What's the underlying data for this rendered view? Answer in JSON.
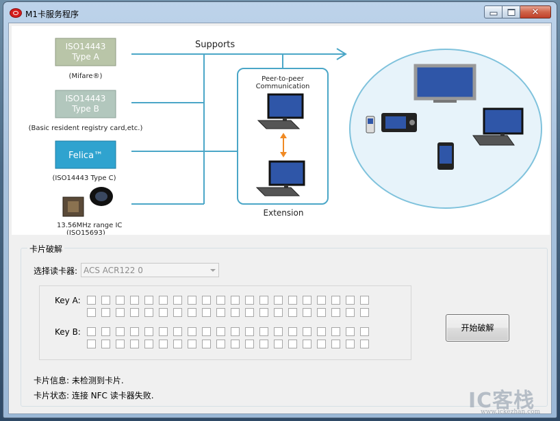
{
  "window": {
    "title": "M1卡服务程序"
  },
  "banner": {
    "supports": "Supports",
    "type_a": [
      "ISO14443",
      "Type A"
    ],
    "mifare": "(Mifare®)",
    "type_b": [
      "ISO14443",
      "Type B"
    ],
    "basic_resident": "(Basic resident registry card,etc.)",
    "felica": "Felica™",
    "type_c": "(ISO14443 Type C)",
    "range_ic": "13.56MHz range IC",
    "iso15693": "(ISO15693)",
    "p2p": [
      "Peer-to-peer",
      "Communication"
    ],
    "extension": "Extension"
  },
  "crack": {
    "group_label": "卡片破解",
    "reader_label": "选择读卡器:",
    "reader_value": "ACS ACR122 0",
    "key_a_label": "Key A:",
    "key_b_label": "Key B:",
    "start_button": "开始破解",
    "card_info": "卡片信息: 未检测到卡片.",
    "card_status": "卡片状态: 连接 NFC 读卡器失败."
  },
  "watermark": {
    "brand": "IC客栈",
    "url": "www.ickezhan.com"
  },
  "colors": {
    "line": "#4aa6c7",
    "felica": "#2fa3cf",
    "chip": "#b9c5a8"
  }
}
